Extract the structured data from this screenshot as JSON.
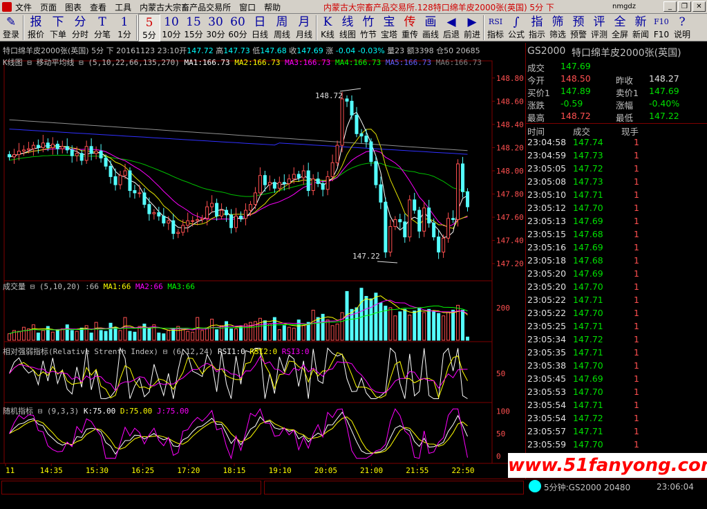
{
  "menubar": {
    "items": [
      "文件",
      "页面",
      "图表",
      "查看",
      "工具",
      "内蒙古大宗畜产品交易所",
      "窗口",
      "帮助"
    ],
    "window_title": "内蒙古大宗畜产品交易所.128特口绵羊皮2000张(英国) 5分 下",
    "user": "nmgdz"
  },
  "toolbar": {
    "buttons": [
      {
        "icon": "✎",
        "label": "登录"
      },
      {
        "icon": "报",
        "label": "报价"
      },
      {
        "icon": "下",
        "label": "下单"
      },
      {
        "icon": "分",
        "label": "分时"
      },
      {
        "icon": "T",
        "label": "分笔"
      },
      {
        "icon": "1",
        "label": "1分"
      },
      {
        "icon": "5",
        "label": "5分"
      },
      {
        "icon": "10",
        "label": "10分"
      },
      {
        "icon": "15",
        "label": "15分"
      },
      {
        "icon": "30",
        "label": "30分"
      },
      {
        "icon": "60",
        "label": "60分"
      },
      {
        "icon": "日",
        "label": "日线"
      },
      {
        "icon": "周",
        "label": "周线"
      },
      {
        "icon": "月",
        "label": "月线"
      },
      {
        "icon": "K",
        "label": "K线"
      },
      {
        "icon": "线",
        "label": "线图"
      },
      {
        "icon": "竹",
        "label": "竹节"
      },
      {
        "icon": "宝",
        "label": "宝塔"
      },
      {
        "icon": "传",
        "label": "重传"
      },
      {
        "icon": "画",
        "label": "画线"
      },
      {
        "icon": "◀",
        "label": "后退"
      },
      {
        "icon": "▶",
        "label": "前进"
      },
      {
        "icon": "RSI",
        "label": "指标"
      },
      {
        "icon": "∫",
        "label": "公式"
      },
      {
        "icon": "指",
        "label": "指示"
      },
      {
        "icon": "筛",
        "label": "筛选"
      },
      {
        "icon": "预",
        "label": "预警"
      },
      {
        "icon": "评",
        "label": "评测"
      },
      {
        "icon": "全",
        "label": "全屏"
      },
      {
        "icon": "新",
        "label": "新闻"
      },
      {
        "icon": "F10",
        "label": "F10"
      },
      {
        "icon": "?",
        "label": "说明"
      }
    ]
  },
  "chart_header": {
    "name": "特口绵羊皮2000张(英国)",
    "period": "5分",
    "direction": "下",
    "date": "20161123",
    "time": "23:10",
    "open_label": "开",
    "open": "147.72",
    "high_label": "高",
    "high": "147.73",
    "low_label": "低",
    "low": "147.68",
    "close_label": "收",
    "close": "147.69",
    "chg_label": "涨",
    "chg": "-0.04",
    "pct": "-0.03%",
    "vol_label": "量",
    "vol": "23",
    "amt_label": "额",
    "amt": "3398",
    "oi_label": "仓",
    "oi": "50",
    "extra": "20685"
  },
  "chart_data": [
    {
      "type": "candlestick",
      "title": "K线图",
      "indicator": "移动平均线",
      "params": "(5,10,22,66,135,270)",
      "ma": [
        {
          "name": "MA1",
          "value": "166.73",
          "color": "#ffffff"
        },
        {
          "name": "MA2",
          "value": "166.73",
          "color": "#ffff00"
        },
        {
          "name": "MA3",
          "value": "166.73",
          "color": "#ff00ff"
        },
        {
          "name": "MA4",
          "value": "166.73",
          "color": "#00ff00"
        },
        {
          "name": "MA5",
          "value": "166.73",
          "color": "#0000ff"
        },
        {
          "name": "MA6",
          "value": "166.73",
          "color": "#808080"
        }
      ],
      "y_ticks": [
        "148.80",
        "148.60",
        "148.40",
        "148.20",
        "148.00",
        "147.80",
        "147.60",
        "147.40",
        "147.20"
      ],
      "ylim": [
        147.1,
        148.9
      ],
      "annotations": [
        {
          "text": "148.72"
        },
        {
          "text": "147.22"
        }
      ],
      "closes": [
        148.12,
        148.14,
        148.17,
        148.18,
        148.19,
        148.22,
        148.2,
        148.24,
        148.2,
        148.23,
        148.19,
        148.21,
        148.18,
        148.13,
        148.15,
        148.09,
        148.21,
        148.15,
        148.17,
        148.11,
        148.04,
        147.95,
        147.88,
        147.96,
        148.0,
        147.83,
        147.81,
        147.81,
        147.71,
        147.63,
        147.64,
        147.61,
        147.55,
        147.57,
        147.46,
        147.47,
        147.53,
        147.57,
        147.57,
        147.58,
        147.59,
        147.69,
        147.72,
        147.61,
        147.66,
        147.62,
        147.51,
        147.61,
        147.59,
        147.66,
        147.71,
        147.81,
        147.96,
        147.88,
        147.9,
        147.85,
        147.9,
        147.89,
        147.93,
        147.97,
        147.94,
        148.0,
        147.83,
        147.93,
        147.89,
        147.84,
        147.95,
        148.07,
        148.22,
        148.62,
        148.6,
        148.48,
        148.32,
        148.3,
        148.25,
        148.08,
        147.88,
        147.73,
        147.3,
        147.52,
        147.58,
        147.56,
        147.43,
        147.75,
        147.66,
        147.48,
        147.68,
        147.55,
        147.43,
        147.3,
        147.42,
        147.59,
        147.58,
        148.06,
        147.82,
        147.69
      ],
      "x_ticks": [
        "11",
        "14:35",
        "15:30",
        "16:25",
        "17:20",
        "18:15",
        "19:10",
        "20:05",
        "21:00",
        "21:55",
        "22:50"
      ]
    },
    {
      "type": "bar",
      "title": "成交量",
      "params": "(5,10,20)",
      "current": "66",
      "ma": [
        {
          "name": "MA1",
          "value": "66",
          "color": "#ffff00"
        },
        {
          "name": "MA2",
          "value": "66",
          "color": "#ff00ff"
        },
        {
          "name": "MA3",
          "value": "66",
          "color": "#00ff00"
        }
      ],
      "y_ticks": [
        "200"
      ],
      "ylim": [
        0,
        340
      ],
      "values": [
        40,
        60,
        55,
        80,
        70,
        95,
        45,
        60,
        85,
        50,
        65,
        70,
        95,
        60,
        55,
        75,
        90,
        45,
        110,
        60,
        55,
        105,
        80,
        60,
        140,
        55,
        50,
        85,
        100,
        70,
        95,
        45,
        40,
        60,
        70,
        85,
        65,
        55,
        50,
        140,
        60,
        75,
        130,
        65,
        90,
        115,
        70,
        70,
        80,
        100,
        110,
        115,
        135,
        120,
        100,
        140,
        65,
        90,
        80,
        75,
        125,
        90,
        110,
        185,
        140,
        160,
        125,
        90,
        100,
        170,
        300,
        190,
        200,
        320,
        270,
        255,
        290,
        230,
        210,
        200,
        150,
        175,
        190,
        155,
        180,
        200,
        170,
        190,
        175,
        165,
        150,
        170,
        185,
        215,
        185,
        20
      ]
    },
    {
      "type": "line",
      "title": "相对强弱指标(Relative Strenth Index)",
      "params": "(6,12,24)",
      "series": [
        {
          "name": "RSI1",
          "value": "0",
          "color": "#ffffff"
        },
        {
          "name": "RSI2",
          "value": "0",
          "color": "#ffff00"
        },
        {
          "name": "RSI3",
          "value": "0",
          "color": "#ff00ff"
        }
      ],
      "y_ticks": [
        "50"
      ],
      "ylim": [
        0,
        100
      ]
    },
    {
      "type": "line",
      "title": "随机指标",
      "params": "(9,3,3)",
      "series": [
        {
          "name": "K",
          "value": "75.00",
          "color": "#ffffff"
        },
        {
          "name": "D",
          "value": "75.00",
          "color": "#ffff00"
        },
        {
          "name": "J",
          "value": "75.00",
          "color": "#ff00ff"
        }
      ],
      "y_ticks": [
        "100",
        "50",
        "0"
      ],
      "ylim": [
        -10,
        110
      ]
    }
  ],
  "quote_panel": {
    "code": "GS2000",
    "name": "特口绵羊皮2000张(英国)",
    "last_label": "成交",
    "last": "147.69",
    "open_label": "今开",
    "open": "148.50",
    "prev_label": "昨收",
    "prev": "148.27",
    "bid_label": "买价1",
    "bid": "147.89",
    "ask_label": "卖价1",
    "ask": "147.69",
    "chg_label": "涨跌",
    "chg": "-0.59",
    "pct_label": "涨幅",
    "pct": "-0.40%",
    "high_label": "最高",
    "high": "148.72",
    "low_label": "最低",
    "low": "147.22",
    "tick_headers": [
      "时间",
      "成交",
      "现手"
    ],
    "ticks": [
      {
        "time": "23:04:58",
        "price": "147.74",
        "qty": "1"
      },
      {
        "time": "23:04:59",
        "price": "147.73",
        "qty": "1"
      },
      {
        "time": "23:05:05",
        "price": "147.72",
        "qty": "1"
      },
      {
        "time": "23:05:08",
        "price": "147.73",
        "qty": "1"
      },
      {
        "time": "23:05:10",
        "price": "147.71",
        "qty": "1"
      },
      {
        "time": "23:05:12",
        "price": "147.70",
        "qty": "1"
      },
      {
        "time": "23:05:13",
        "price": "147.69",
        "qty": "1"
      },
      {
        "time": "23:05:15",
        "price": "147.68",
        "qty": "1"
      },
      {
        "time": "23:05:16",
        "price": "147.69",
        "qty": "1"
      },
      {
        "time": "23:05:18",
        "price": "147.68",
        "qty": "1"
      },
      {
        "time": "23:05:20",
        "price": "147.69",
        "qty": "1"
      },
      {
        "time": "23:05:20",
        "price": "147.70",
        "qty": "1"
      },
      {
        "time": "23:05:22",
        "price": "147.71",
        "qty": "1"
      },
      {
        "time": "23:05:22",
        "price": "147.70",
        "qty": "1"
      },
      {
        "time": "23:05:25",
        "price": "147.71",
        "qty": "1"
      },
      {
        "time": "23:05:34",
        "price": "147.72",
        "qty": "1"
      },
      {
        "time": "23:05:35",
        "price": "147.71",
        "qty": "1"
      },
      {
        "time": "23:05:38",
        "price": "147.70",
        "qty": "1"
      },
      {
        "time": "23:05:45",
        "price": "147.69",
        "qty": "1"
      },
      {
        "time": "23:05:53",
        "price": "147.70",
        "qty": "1"
      },
      {
        "time": "23:05:54",
        "price": "147.71",
        "qty": "1"
      },
      {
        "time": "23:05:54",
        "price": "147.72",
        "qty": "1"
      },
      {
        "time": "23:05:57",
        "price": "147.71",
        "qty": "1"
      },
      {
        "time": "23:05:59",
        "price": "147.70",
        "qty": "1"
      }
    ]
  },
  "statusbar": {
    "stock": "5分钟:GS2000",
    "value": "20480",
    "time": "23:06:04"
  },
  "watermark": "www.51fanyong.com",
  "colors": {
    "up": "#ff5050",
    "down": "#54ffff",
    "frame": "#800000",
    "axis_text": "#ff5050"
  }
}
